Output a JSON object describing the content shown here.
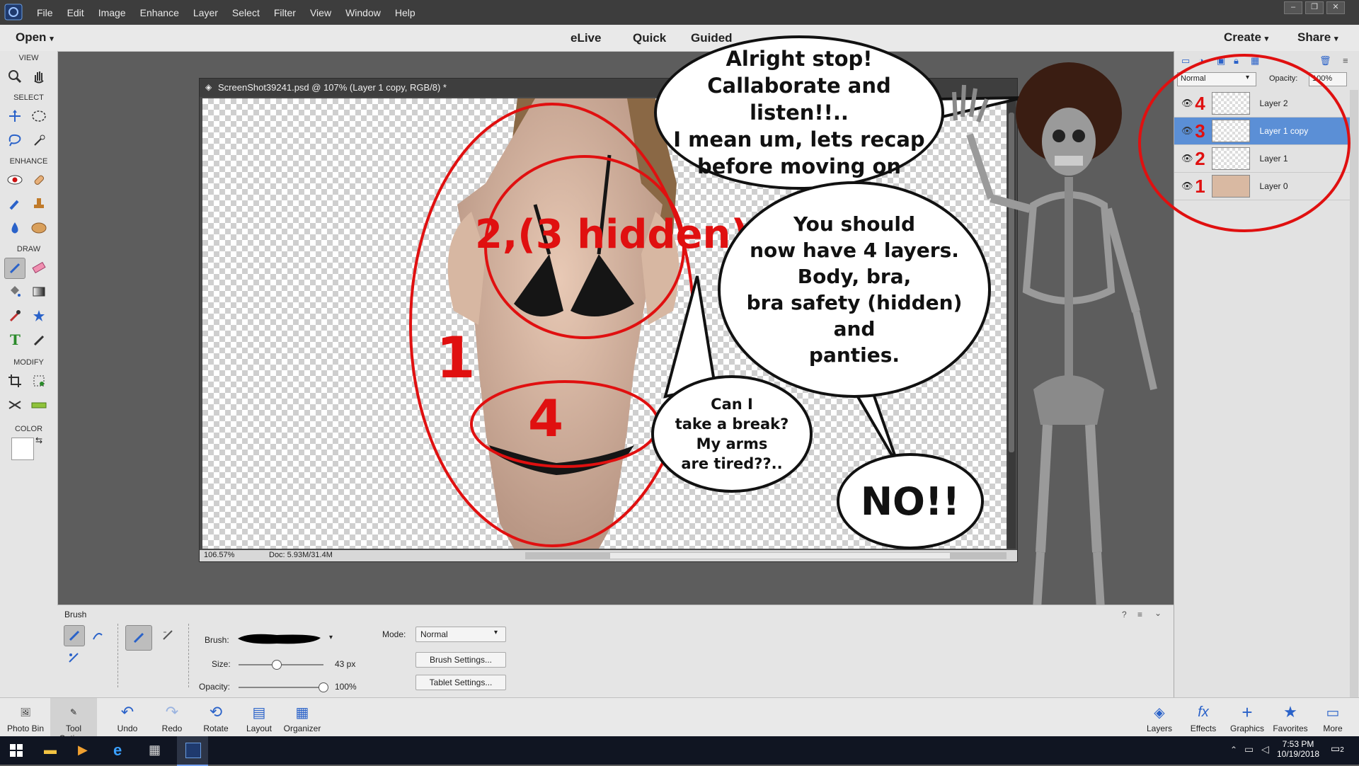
{
  "menubar": {
    "items": [
      "File",
      "Edit",
      "Image",
      "Enhance",
      "Layer",
      "Select",
      "Filter",
      "View",
      "Window",
      "Help"
    ]
  },
  "modebar": {
    "open": "Open",
    "modes": [
      "eLive",
      "Quick",
      "Guided"
    ],
    "create": "Create",
    "share": "Share"
  },
  "toolbox": {
    "sections": [
      "VIEW",
      "SELECT",
      "ENHANCE",
      "DRAW",
      "MODIFY",
      "COLOR"
    ]
  },
  "document": {
    "title": "ScreenShot39241.psd @ 107% (Layer 1 copy, RGB/8) *",
    "zoom": "106.57%",
    "doc_size": "Doc: 5.93M/31.4M"
  },
  "annotations": {
    "label_1": "1",
    "label_2": "2,(3 hidden)",
    "label_4": "4"
  },
  "bubbles": {
    "b1": "Alright stop!\nCallaborate and listen!!..\nI mean um, lets recap\nbefore moving on",
    "b2": "You should\nnow have 4 layers.\nBody, bra,\nbra safety (hidden)\nand\npanties.",
    "b3": "Can I\ntake a break?\nMy arms\nare tired??..",
    "b4": "NO!!"
  },
  "layers_panel": {
    "blend_mode": "Normal",
    "opacity_label": "Opacity:",
    "opacity_value": "100%",
    "layers": [
      {
        "num": "4",
        "name": "Layer 2"
      },
      {
        "num": "3",
        "name": "Layer 1 copy"
      },
      {
        "num": "2",
        "name": "Layer 1"
      },
      {
        "num": "1",
        "name": "Layer 0"
      }
    ]
  },
  "tool_options": {
    "title": "Brush",
    "brush_label": "Brush:",
    "size_label": "Size:",
    "size_value": "43 px",
    "size_fraction": 0.45,
    "opacity_label": "Opacity:",
    "opacity_value": "100%",
    "opacity_fraction": 1.0,
    "mode_label": "Mode:",
    "mode_value": "Normal",
    "brush_settings": "Brush Settings...",
    "tablet_settings": "Tablet Settings..."
  },
  "bottombar": {
    "left": [
      "Photo Bin",
      "Tool Options",
      "Undo",
      "Redo",
      "Rotate",
      "Layout",
      "Organizer"
    ],
    "right": [
      "Layers",
      "Effects",
      "Graphics",
      "Favorites",
      "More"
    ]
  },
  "taskbar": {
    "time": "7:53 PM",
    "date": "10/19/2018",
    "notifications": "2"
  },
  "colors": {
    "accent_red": "#e01010",
    "selection_blue": "#5b8fd6"
  }
}
